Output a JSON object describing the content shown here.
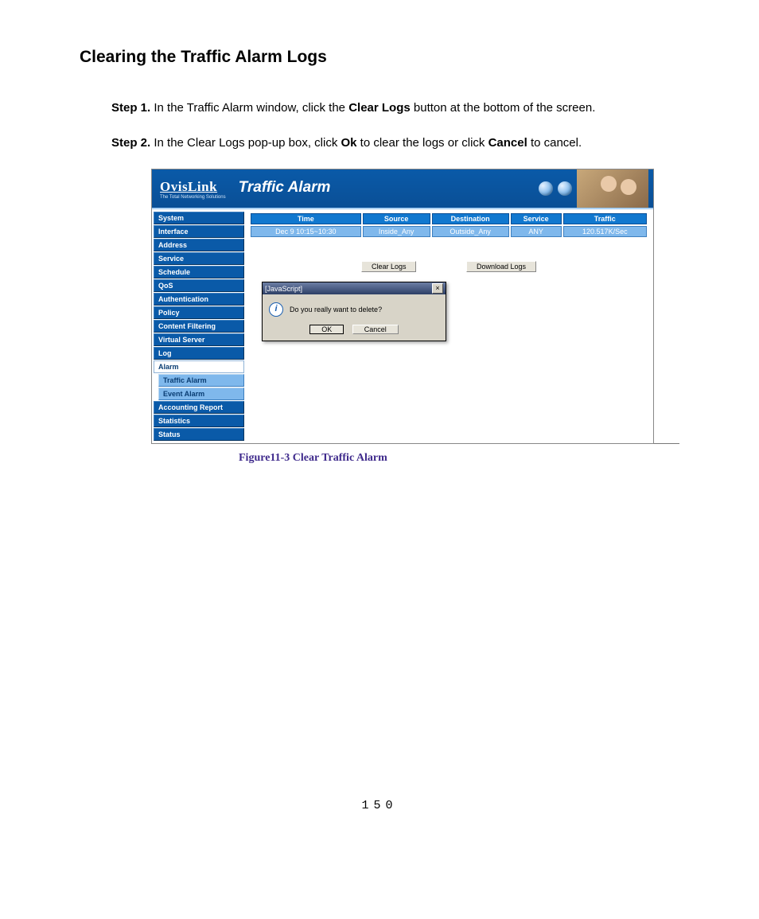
{
  "heading": "Clearing the Traffic Alarm Logs",
  "steps": {
    "s1": {
      "label": "Step 1.",
      "t1": " In the Traffic Alarm window, click the ",
      "b1": "Clear Logs",
      "t2": " button at the bottom of the screen."
    },
    "s2": {
      "label": "Step 2.",
      "t1": " In the Clear Logs pop-up box, click ",
      "b1": "Ok",
      "t2": " to clear the logs or click ",
      "b2": "Cancel",
      "t3": " to cancel."
    }
  },
  "shot": {
    "brand": {
      "name": "OvisLink",
      "tag": "The Total Networking Solutions"
    },
    "title": "Traffic Alarm",
    "nav": {
      "i0": "System",
      "i1": "Interface",
      "i2": "Address",
      "i3": "Service",
      "i4": "Schedule",
      "i5": "QoS",
      "i6": "Authentication",
      "i7": "Policy",
      "i8": "Content Filtering",
      "i9": "Virtual Server",
      "i10": "Log",
      "i11": "Alarm",
      "sub": {
        "s0": "Traffic Alarm",
        "s1": "Event Alarm"
      },
      "i12": "Accounting Report",
      "i13": "Statistics",
      "i14": "Status"
    },
    "table": {
      "h": {
        "time": "Time",
        "source": "Source",
        "dest": "Destination",
        "service": "Service",
        "traffic": "Traffic"
      },
      "r0": {
        "time": "Dec 9 10:15~10:30",
        "source": "Inside_Any",
        "dest": "Outside_Any",
        "service": "ANY",
        "traffic": "120.517K/Sec"
      }
    },
    "buttons": {
      "clear": "Clear Logs",
      "download": "Download Logs"
    },
    "dialog": {
      "title": "[JavaScript]",
      "close": "×",
      "msg": "Do you really want to delete?",
      "ok": "OK",
      "cancel": "Cancel"
    }
  },
  "caption": "Figure11-3 Clear Traffic Alarm",
  "pagenum": "150"
}
